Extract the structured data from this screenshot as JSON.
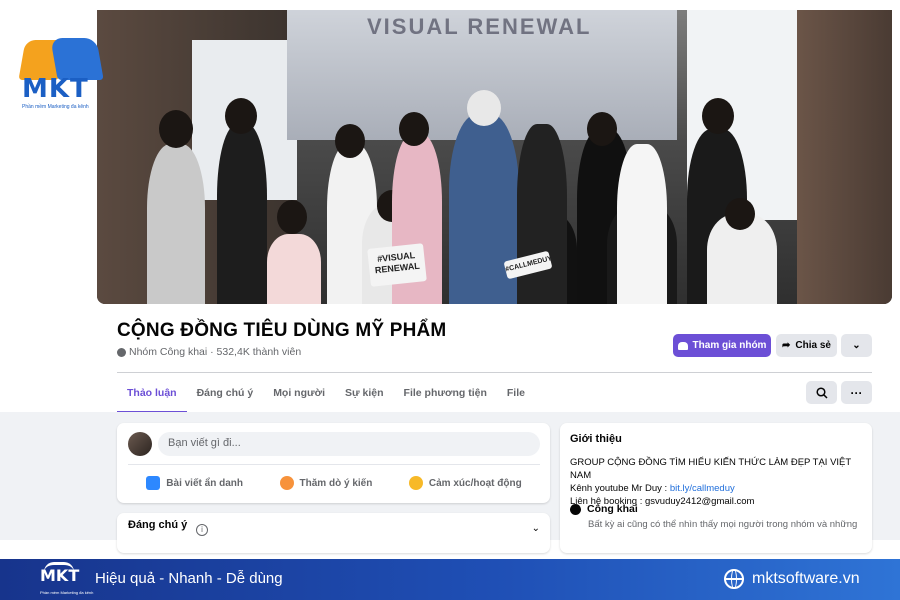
{
  "logo": {
    "text": "MKT",
    "tagline": "Phần mềm Marketing đa kênh"
  },
  "cover": {
    "banner_text": "VISUAL RENEWAL",
    "sign_text": "#VISUAL RENEWAL",
    "sign2_text": "#CALLMEDUY"
  },
  "group": {
    "title": "CỘNG ĐỒNG TIÊU DÙNG MỸ PHẨM",
    "meta": "Nhóm Công khai · 532,4K thành viên"
  },
  "buttons": {
    "join": "Tham gia nhóm",
    "share": "Chia sẻ",
    "more": "⌄",
    "dots": "···"
  },
  "tabs": [
    {
      "label": "Thảo luận"
    },
    {
      "label": "Đáng chú ý"
    },
    {
      "label": "Mọi người"
    },
    {
      "label": "Sự kiện"
    },
    {
      "label": "File phương tiện"
    },
    {
      "label": "File"
    }
  ],
  "composer": {
    "placeholder": "Bạn viết gì đi...",
    "actions": [
      {
        "label": "Bài viết ẩn danh",
        "icon": "anonymous-icon"
      },
      {
        "label": "Thăm dò ý kiến",
        "icon": "poll-icon"
      },
      {
        "label": "Cảm xúc/hoạt động",
        "icon": "feeling-icon"
      }
    ]
  },
  "featured": {
    "title": "Đáng chú ý",
    "info": "i",
    "chevron": "⌄"
  },
  "about": {
    "title": "Giới thiệu",
    "line1": "GROUP CỘNG ĐỒNG TÌM HIỂU KIẾN THỨC LÀM ĐẸP TẠI VIỆT NAM",
    "line2_prefix": "Kênh youtube Mr Duy : ",
    "line2_link": "bit.ly/callmeduy",
    "line3": "Liên hệ booking : gsvuduy2412@gmail.com",
    "public_title": "Công khai",
    "public_desc": "Bất kỳ ai cũng có thể nhìn thấy mọi người trong nhóm và những"
  },
  "footer": {
    "logo_text": "MKT",
    "logo_tagline": "Phần mềm Marketing đa kênh",
    "slogan": "Hiệu quả - Nhanh - Dễ dùng",
    "website": "mktsoftware.vn"
  },
  "colors": {
    "accent": "#6c4fd6",
    "link": "#216fdb",
    "footer_start": "#17348c",
    "footer_end": "#2f74d6"
  }
}
